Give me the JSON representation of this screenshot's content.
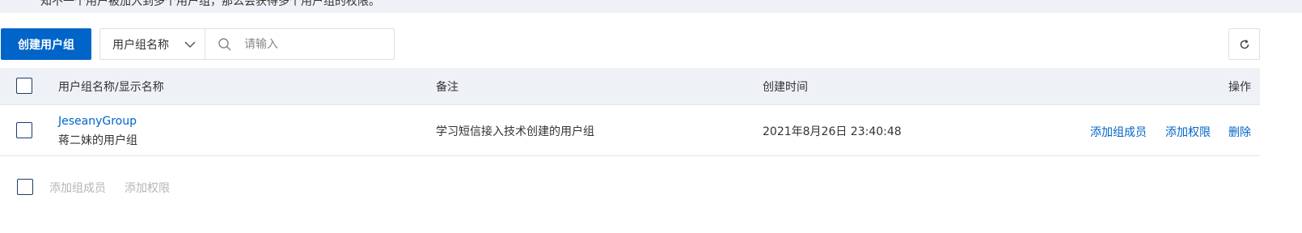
{
  "banner": {
    "text": "知不一个用户被加入到多个用户组，那么会获得多个用户组的权限。"
  },
  "toolbar": {
    "create_label": "创建用户组",
    "filter_select_value": "用户组名称",
    "search_placeholder": "请输入"
  },
  "table": {
    "headers": {
      "name": "用户组名称/显示名称",
      "remark": "备注",
      "created": "创建时间",
      "actions": "操作"
    },
    "rows": [
      {
        "group_name": "JeseanyGroup",
        "display_name": "蒋二妹的用户组",
        "remark": "学习短信接入技术创建的用户组",
        "created": "2021年8月26日 23:40:48",
        "action_add_member": "添加组成员",
        "action_add_permission": "添加权限",
        "action_delete": "删除"
      }
    ]
  },
  "footer": {
    "bulk_add_member": "添加组成员",
    "bulk_add_permission": "添加权限"
  },
  "colors": {
    "primary": "#0064c8",
    "header_bg": "#eef1f5",
    "disabled_text": "#b5b5b5"
  },
  "icons": [
    "chevron-down-icon",
    "search-icon",
    "refresh-icon"
  ]
}
